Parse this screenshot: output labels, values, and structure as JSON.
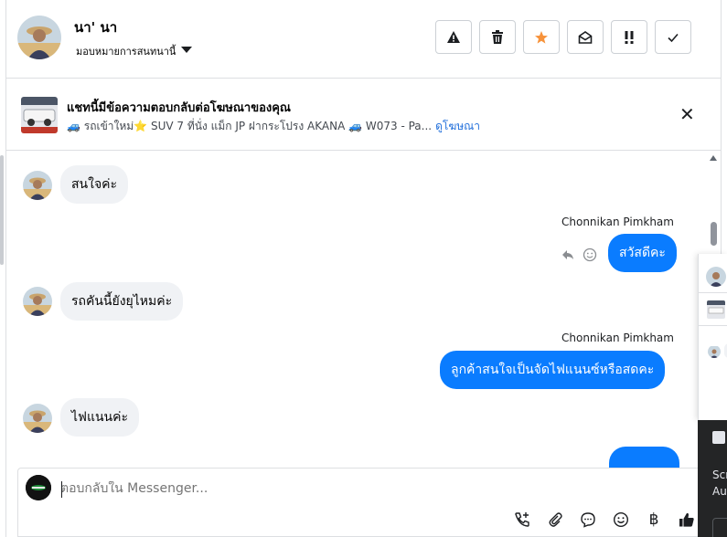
{
  "header": {
    "contact_name": "นา' นา",
    "assign_label": "มอบหมายการสนทนานี้",
    "toolbar": [
      {
        "name": "spam-button",
        "icon": "warning-icon",
        "glyph": "⚠"
      },
      {
        "name": "delete-button",
        "icon": "trash-icon",
        "glyph": "🗑"
      },
      {
        "name": "star-button",
        "icon": "star-icon",
        "glyph": "★"
      },
      {
        "name": "mark-unread-button",
        "icon": "envelope-open-icon",
        "glyph": "✉"
      },
      {
        "name": "follow-up-button",
        "icon": "exclamation-icon",
        "glyph": "!!"
      },
      {
        "name": "mark-done-button",
        "icon": "check-icon",
        "glyph": "✓"
      }
    ]
  },
  "ad": {
    "title": "แชทนี้มีข้อความตอบกลับต่อโฆษณาของคุณ",
    "subtitle": "🚙 รถเข้าใหม่⭐ SUV 7 ที่นั่ง แม็ก JP ฝากระโปรง AKANA 🚙 W073 - Pa...",
    "link_label": "ดูโฆษณา",
    "close_glyph": "✕"
  },
  "messages": [
    {
      "direction": "in",
      "text": "สนใจค่ะ"
    },
    {
      "direction": "out",
      "sender": "Chonnikan Pimkham",
      "text": "สวัสดีคะ"
    },
    {
      "direction": "in",
      "text": "รถคันนี้ยังยุไหมค่ะ"
    },
    {
      "direction": "out",
      "sender": "Chonnikan Pimkham",
      "text": "ลูกค้าสนใจเป็นจัดไฟแนนซ์หรือสดคะ"
    },
    {
      "direction": "in",
      "text": "ไฟแนนค่ะ"
    }
  ],
  "composer": {
    "placeholder": "ตอบกลับใน Messenger...",
    "icons": [
      {
        "name": "call-add-icon",
        "glyph": "☏"
      },
      {
        "name": "attachment-icon",
        "glyph": "📎"
      },
      {
        "name": "saved-reply-icon",
        "glyph": "💬"
      },
      {
        "name": "emoji-icon",
        "glyph": "☺"
      },
      {
        "name": "payment-baht-icon",
        "glyph": "฿"
      },
      {
        "name": "thumbs-up-icon",
        "glyph": "👍"
      }
    ]
  },
  "side_popup": {
    "dark_line1": "Scr",
    "dark_line2": "Au"
  },
  "colors": {
    "accent": "#0a7cff",
    "incoming_bubble": "#f0f2f5",
    "link": "#216fdb",
    "star": "#f7923a"
  }
}
